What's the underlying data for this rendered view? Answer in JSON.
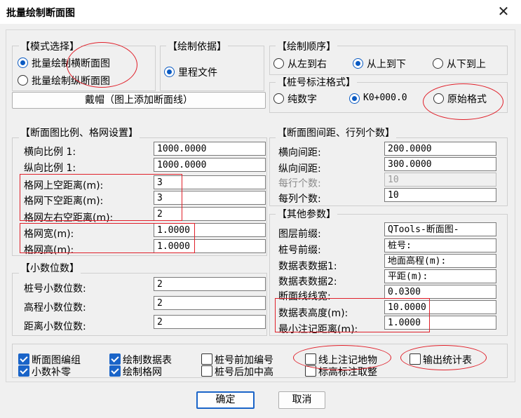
{
  "window": {
    "title": "批量绘制断面图",
    "close_glyph": "✕"
  },
  "mode": {
    "title": "【模式选择】",
    "options": [
      "批量绘制横断面图",
      "批量绘制纵断面图"
    ],
    "selected": 0,
    "cap_button": "戴帽（图上添加断面线）"
  },
  "basis": {
    "title": "【绘制依据】",
    "option": "里程文件"
  },
  "order": {
    "title": "【绘制顺序】",
    "options": [
      "从左到右",
      "从上到下",
      "从下到上"
    ],
    "selected": 1
  },
  "stake_format": {
    "title": "【桩号标注格式】",
    "options": [
      "纯数字",
      "K0+000.0",
      "原始格式"
    ],
    "selected": 1
  },
  "scale_grid": {
    "title": "【断面图比例、格网设置】",
    "rows": [
      {
        "label": "横向比例 1:",
        "value": "1000.0000"
      },
      {
        "label": "纵向比例 1:",
        "value": "1000.0000"
      },
      {
        "label": "格网上空距离(m):",
        "value": "3"
      },
      {
        "label": "格网下空距离(m):",
        "value": "3"
      },
      {
        "label": "格网左右空距离(m):",
        "value": "2"
      },
      {
        "label": "格网宽(m):",
        "value": "1.0000"
      },
      {
        "label": "格网高(m):",
        "value": "1.0000"
      }
    ]
  },
  "decimals": {
    "title": "【小数位数】",
    "rows": [
      {
        "label": "桩号小数位数:",
        "value": "2"
      },
      {
        "label": "高程小数位数:",
        "value": "2"
      },
      {
        "label": "距离小数位数:",
        "value": "2"
      }
    ]
  },
  "spacing": {
    "title": "【断面图间距、行列个数】",
    "rows": [
      {
        "label": "横向间距:",
        "value": "200.0000"
      },
      {
        "label": "纵向间距:",
        "value": "300.0000"
      },
      {
        "label": "每行个数:",
        "value": "10"
      },
      {
        "label": "每列个数:",
        "value": "10"
      }
    ]
  },
  "other": {
    "title": "【其他参数】",
    "rows": [
      {
        "label": "图层前缀:",
        "value": "QTools-断面图-"
      },
      {
        "label": "桩号前缀:",
        "value": "桩号:"
      },
      {
        "label": "数据表数据1:",
        "value": "地面高程(m):"
      },
      {
        "label": "数据表数据2:",
        "value": "平距(m):"
      },
      {
        "label": "断面线线宽:",
        "value": "0.0300"
      },
      {
        "label": "数据表高度(m):",
        "value": "10.0000"
      },
      {
        "label": "最小注记距离(m):",
        "value": "1.0000"
      }
    ]
  },
  "options": {
    "items": [
      {
        "label": "断面图编组",
        "checked": true
      },
      {
        "label": "小数补零",
        "checked": true
      },
      {
        "label": "绘制数据表",
        "checked": true
      },
      {
        "label": "绘制格网",
        "checked": true
      },
      {
        "label": "桩号前加编号",
        "checked": false
      },
      {
        "label": "桩号后加中高",
        "checked": false
      },
      {
        "label": "线上注记地物",
        "checked": false
      },
      {
        "label": "标高标注取整",
        "checked": false
      },
      {
        "label": "输出统计表",
        "checked": false
      }
    ]
  },
  "footer": {
    "ok": "确定",
    "cancel": "取消"
  },
  "colors": {
    "accent": "#1a64c8",
    "annotation": "#e0202a"
  }
}
